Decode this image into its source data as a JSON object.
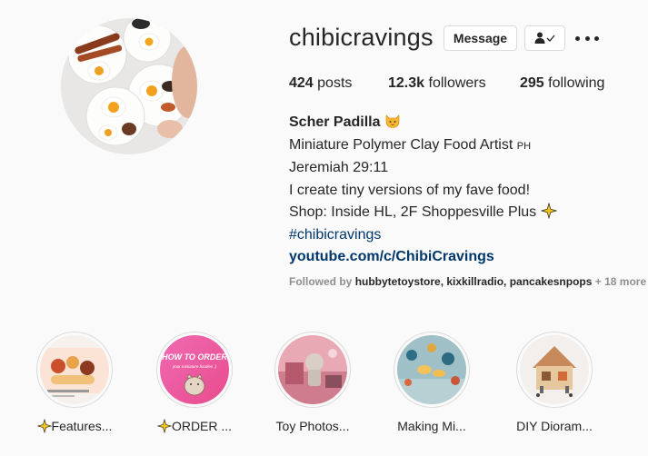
{
  "profile": {
    "username": "chibicravings",
    "message_label": "Message",
    "follow_icon": "person-check-icon",
    "more_icon": "more-dots-icon",
    "avatar": "avatar-miniature-breakfast-plates"
  },
  "stats": {
    "posts_count": "424",
    "posts_label": "posts",
    "followers_count": "12.3k",
    "followers_label": "followers",
    "following_count": "295",
    "following_label": "following"
  },
  "bio": {
    "name": "Scher Padilla",
    "name_emoji": "cat-face-emoji",
    "line1": "Miniature Polymer Clay Food Artist",
    "line1_suffix": "PH",
    "line2": "Jeremiah 29:11",
    "line3": "I create tiny versions of my fave food!",
    "line4": "Shop: Inside HL, 2F Shoppesville Plus",
    "line4_emoji": "sparkles-emoji",
    "hashtag": "#chibicravings",
    "link": "youtube.com/c/ChibiCravings"
  },
  "followed_by": {
    "prefix": "Followed by",
    "users": "hubbytetoystore, kixkillradio, pancakesnpops",
    "more": "+ 18 more"
  },
  "highlights": [
    {
      "label": "Features...",
      "emoji": "sparkles-emoji"
    },
    {
      "label": "ORDER ...",
      "emoji": "sparkles-emoji",
      "title": "HOW TO ORDER",
      "subtitle": "your miniature foodies :)"
    },
    {
      "label": "Toy Photos..."
    },
    {
      "label": "Making Mi..."
    },
    {
      "label": "DIY Dioram..."
    }
  ],
  "colors": {
    "text": "#262626",
    "muted": "#8e8e8e",
    "link": "#00376b",
    "border": "#dbdbdb",
    "background": "#fafafa"
  }
}
